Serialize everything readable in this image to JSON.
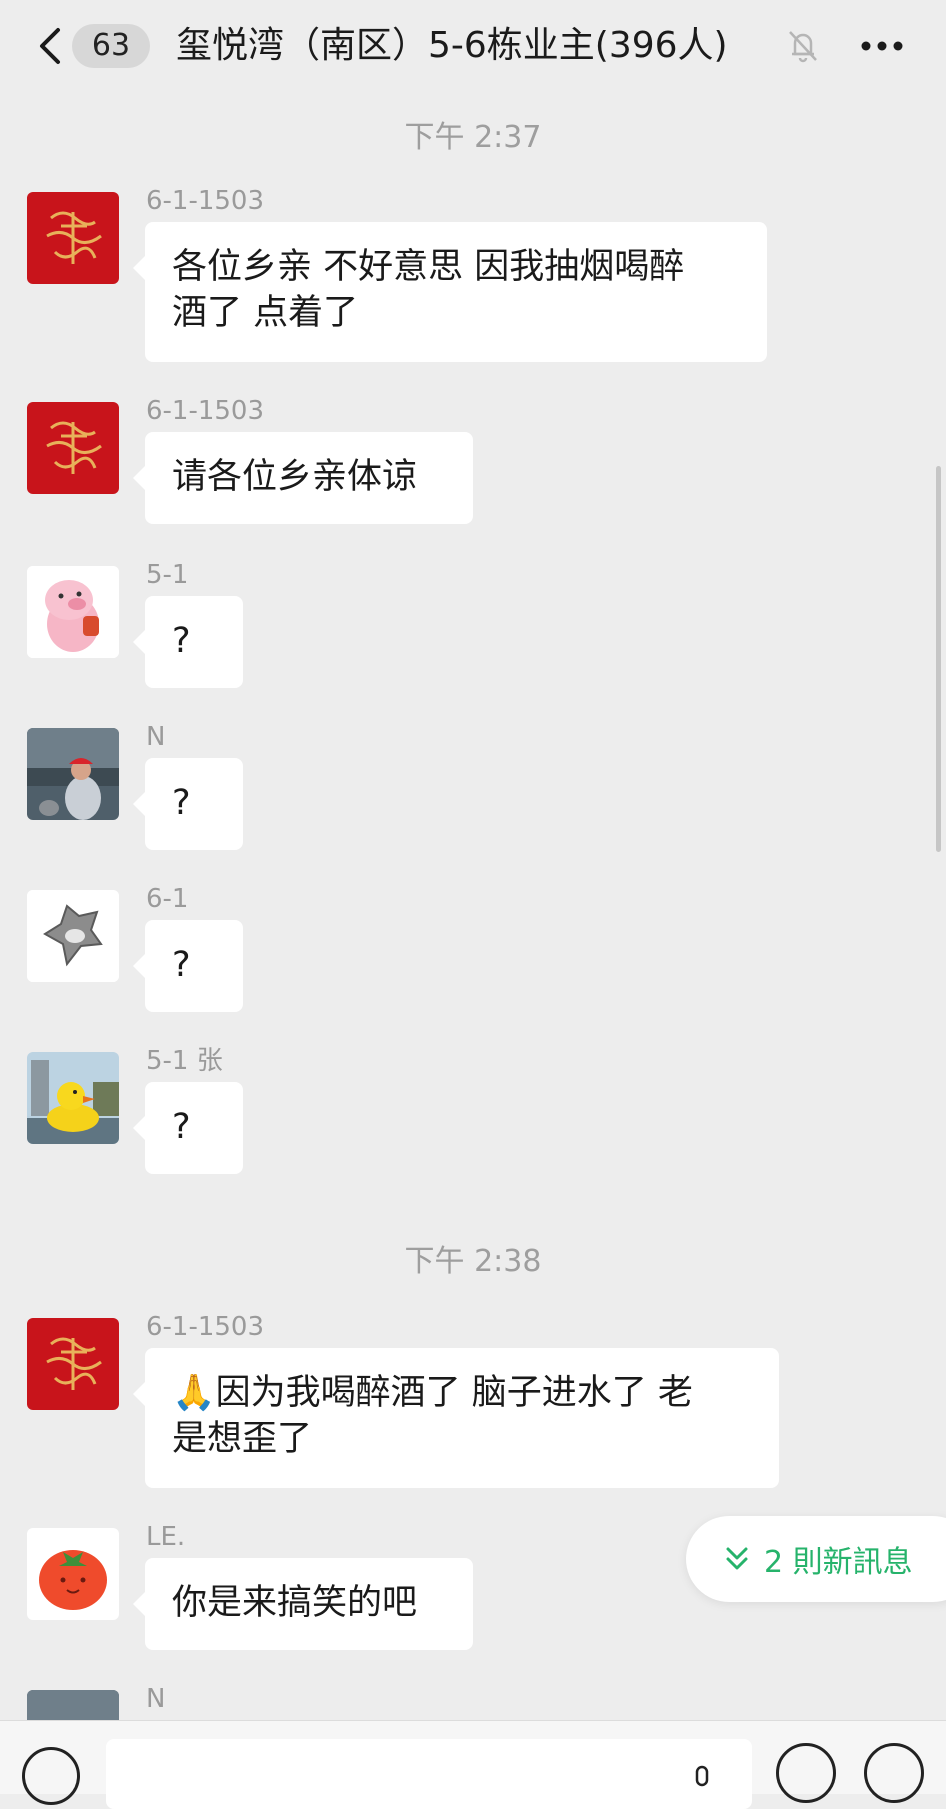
{
  "header": {
    "unread_count": "63",
    "title": "玺悦湾（南区）5-6栋业主(396人)"
  },
  "timestamps": [
    "下午 2:37",
    "下午 2:38"
  ],
  "messages": [
    {
      "sender": "6-1-1503",
      "text_lines": [
        "各位乡亲 不好意思 因我抽烟喝醉",
        "酒了 点着了"
      ],
      "avatar": "red-fu-avatar"
    },
    {
      "sender": "6-1-1503",
      "text_lines": [
        "请各位乡亲体谅"
      ],
      "avatar": "red-fu-avatar"
    },
    {
      "sender": "5-1",
      "text_lines": [
        "?"
      ],
      "avatar": "pig-avatar"
    },
    {
      "sender": "N",
      "text_lines": [
        "?"
      ],
      "avatar": "photo-person-avatar"
    },
    {
      "sender": "6-1",
      "text_lines": [
        "?"
      ],
      "avatar": "silver-shape-avatar"
    },
    {
      "sender": "5-1 张",
      "text_lines": [
        "?"
      ],
      "avatar": "duck-avatar"
    },
    {
      "sender": "6-1-1503",
      "text_lines": [
        "🙏因为我喝醉酒了 脑子进水了 老",
        "是想歪了"
      ],
      "avatar": "red-fu-avatar"
    },
    {
      "sender": "LE.",
      "text_lines": [
        "你是来搞笑的吧"
      ],
      "avatar": "tomato-avatar"
    },
    {
      "sender": "N",
      "text_lines": [],
      "avatar": "photo-person-avatar"
    }
  ],
  "new_messages_label": "2 則新訊息",
  "colors": {
    "background": "#ededed",
    "bubble": "#ffffff",
    "accent_green": "#26b36b",
    "fu_red": "#c8141b"
  }
}
